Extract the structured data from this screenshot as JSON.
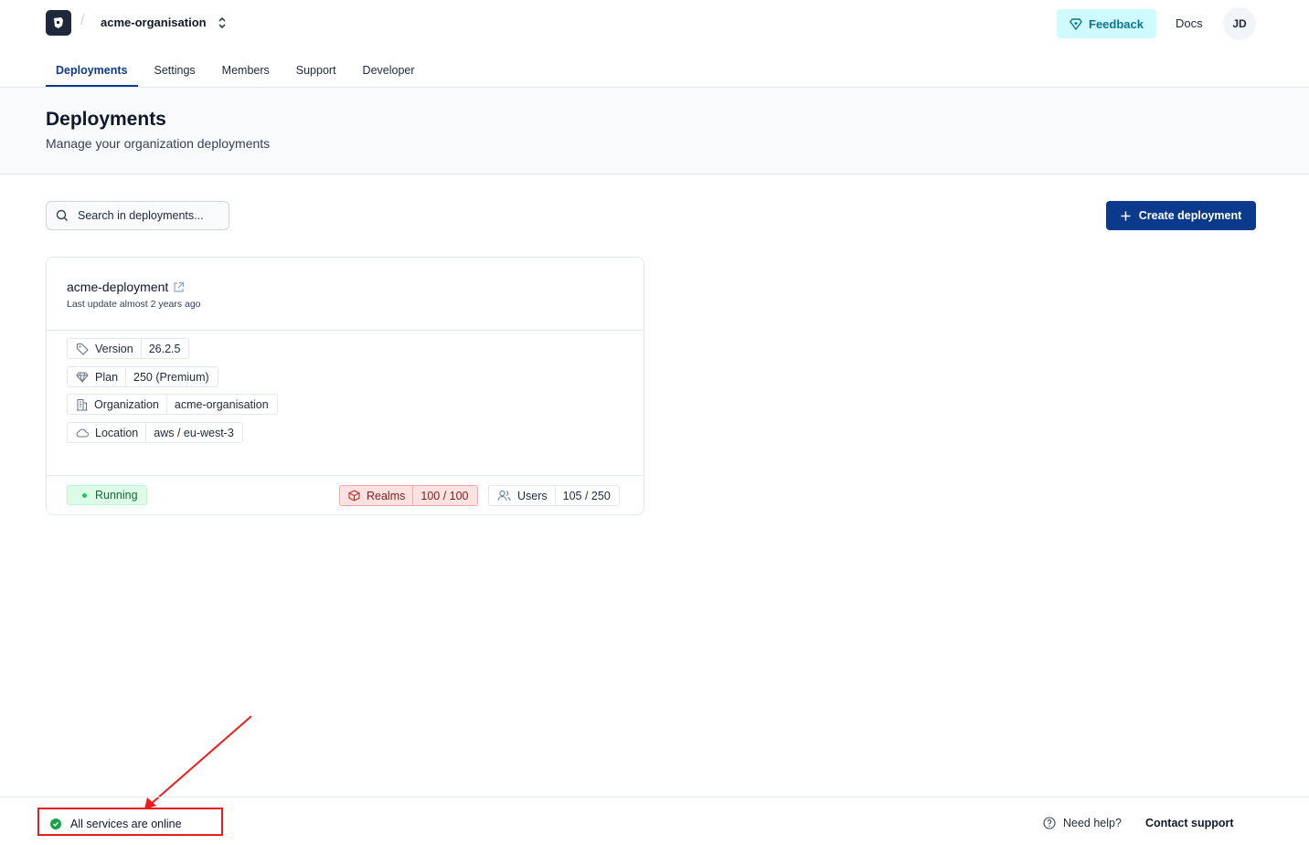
{
  "header": {
    "org_name": "acme-organisation",
    "feedback_label": "Feedback",
    "docs_label": "Docs",
    "avatar_initials": "JD"
  },
  "tabs": [
    {
      "label": "Deployments",
      "active": true
    },
    {
      "label": "Settings",
      "active": false
    },
    {
      "label": "Members",
      "active": false
    },
    {
      "label": "Support",
      "active": false
    },
    {
      "label": "Developer",
      "active": false
    }
  ],
  "page": {
    "title": "Deployments",
    "subtitle": "Manage your organization deployments"
  },
  "toolbar": {
    "search_placeholder": "Search in deployments...",
    "create_label": "Create deployment"
  },
  "deployment": {
    "name": "acme-deployment",
    "last_update": "Last update almost 2 years ago",
    "details": [
      {
        "key": "Version",
        "value": "26.2.5",
        "icon": "tag-icon"
      },
      {
        "key": "Plan",
        "value": "250 (Premium)",
        "icon": "diamond-icon"
      },
      {
        "key": "Organization",
        "value": "acme-organisation",
        "icon": "building-icon"
      },
      {
        "key": "Location",
        "value": "aws / eu-west-3",
        "icon": "cloud-icon"
      }
    ],
    "status": "Running",
    "realms": {
      "key": "Realms",
      "value": "100 / 100"
    },
    "users": {
      "key": "Users",
      "value": "105 / 250"
    }
  },
  "footer": {
    "services_status": "All services are online",
    "help_label": "Need help?",
    "contact_label": "Contact support"
  },
  "colors": {
    "primary": "#0b3a8c",
    "feedback_bg": "#cffafe",
    "running_bg": "#dcfce7",
    "warn_bg": "#fee2e2",
    "annotation": "#ef1b1b"
  }
}
